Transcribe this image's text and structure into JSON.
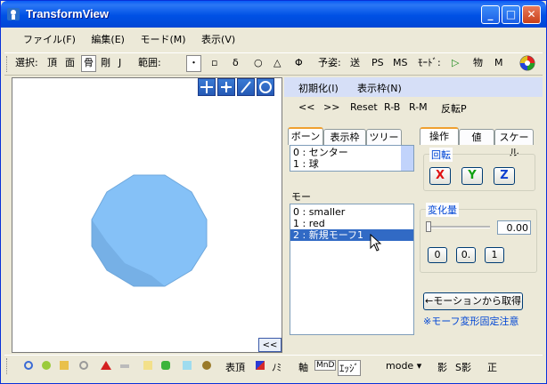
{
  "window": {
    "title": "TransformView"
  },
  "menu": [
    "ファイル(F)",
    "編集(E)",
    "モード(M)",
    "表示(V)"
  ],
  "toolbar": {
    "select_label": "選択:",
    "sel_vertex": "頂",
    "sel_face": "面",
    "sel_bone": "骨",
    "sel_rigid": "剛",
    "sel_joint": "J",
    "range_label": "範囲:",
    "range_point": "・",
    "range_square": "▫",
    "range_delta": "δ",
    "range_circle": "○",
    "range_triangle": "△",
    "range_phi": "Φ",
    "preview_label": "予姿:",
    "preview_send": "送",
    "preview_ps": "PS",
    "preview_ms": "MS",
    "mode_label": "ﾓｰﾄﾞ:",
    "mode_play": "▷",
    "mode_physics": "物",
    "mode_m": "M"
  },
  "viewport": {
    "collapse_label": "<<",
    "shape_color": "#7fbff6"
  },
  "panel": {
    "init_label": "初期化(I)",
    "frame_label": "表示枠(N)",
    "nav": [
      "<<",
      ">>",
      "Reset",
      "R-B",
      "R-M",
      "反転P"
    ],
    "bone_tabs": [
      "ボーン",
      "表示枠",
      "ツリー"
    ],
    "bone_list": [
      "0 : センター",
      "1 : 球"
    ],
    "op_tabs": [
      "操作",
      "値",
      "スケール"
    ],
    "rotation_label": "回転",
    "axis_x": "X",
    "axis_y": "Y",
    "axis_z": "Z",
    "morph_label": "モー",
    "morph_list": [
      "0 : smaller",
      "1 : red",
      "2 : 新規モーフ1"
    ],
    "delta_label": "変化量",
    "delta_value": "0.00",
    "preset_buttons": [
      "0",
      "0.",
      "1"
    ],
    "motion_button": "←モーションから取得",
    "note": "※モーフ変形固定注意"
  },
  "statusbar": {
    "show_vertex": "表頂",
    "no_label": "ﾉﾐ",
    "axis_label": "軸",
    "mn_label": "MnD",
    "edge_label": "ｴｯｼﾞ",
    "mode_dropdown": "mode ▾",
    "shadow_label": "影",
    "sshadow_label": "S影",
    "correct_label": "正"
  }
}
